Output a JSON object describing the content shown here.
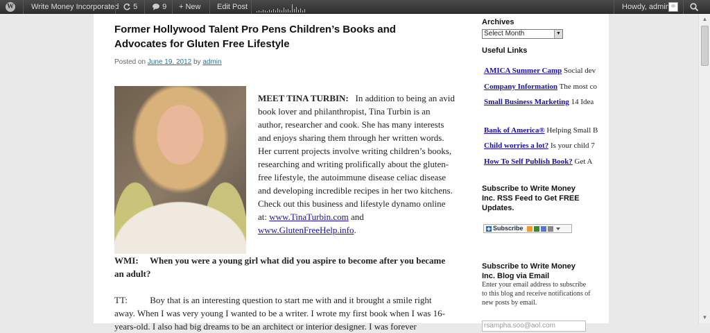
{
  "adminbar": {
    "site_name": "Write Money Incorporated",
    "updates_count": "5",
    "comments_count": "9",
    "new_label": "+ New",
    "edit_post_label": "Edit Post",
    "greeting": "Howdy, admin"
  },
  "post": {
    "title": "Former Hollywood Talent Pro Pens Children’s Books and Advocates for Gluten Free Lifestyle",
    "meta_posted_on": "Posted on",
    "meta_date": "June 19, 2012",
    "meta_by": "by",
    "meta_author": "admin",
    "intro_heading": "MEET TINA TURBIN:",
    "intro_text": "In addition to being an avid book lover and philanthropist, Tina Turbin is an author, researcher and cook. She has many interests and enjoys sharing them through her written words. Her current projects involve writing children’s books, researching and writing prolifically about the gluten-free lifestyle, the autoimmune disease celiac disease and developing incredible recipes in her two kitchens. Check out this business and lifestyle dynamo online at:",
    "link1": "www.TinaTurbin.com",
    "and_text": "and",
    "link2": "www.GlutenFreeHelp.info",
    "period": ".",
    "q1_label": "WMI:",
    "q1_text": "When you were a young girl what did you aspire to become after you became an adult?",
    "a1_label": "TT:",
    "a1_text": "Boy that is an interesting question to start me with and it brought a smile right away. When I was very young I wanted to be a writer.  I wrote my first book when I was 16-years-old. I also had big dreams to be an architect or interior designer. I was forever"
  },
  "sidebar": {
    "archives_title": "Archives",
    "archives_select": "Select Month",
    "useful_links_title": "Useful Links",
    "links": [
      {
        "name": "AMICA Summer Camp",
        "desc": "Social dev"
      },
      {
        "name": "Company Information",
        "desc": "The most co"
      },
      {
        "name": "Small Business Marketing",
        "desc": "14 Idea"
      },
      {
        "name": "Bank of America®",
        "desc": "Helping Small B"
      },
      {
        "name": "Child worries a lot?",
        "desc": "Is your child 7"
      },
      {
        "name": "How To Self Publish Book?",
        "desc": "Get A"
      }
    ],
    "rss_title": "Subscribe to Write Money Inc. RSS Feed to Get FREE Updates.",
    "subscribe_label": "Subscribe",
    "email_title": "Subscribe to Write Money Inc. Blog via Email",
    "email_desc": "Enter your email address to subscribe to this blog and receive notifications of new posts by email.",
    "email_value": "rsampha.soo@aol.com"
  },
  "colors": {
    "adminbar": "#2f2f2f",
    "link": "#1a0dab",
    "meta_link": "#21759b",
    "page_bg": "#e9e9e9"
  }
}
